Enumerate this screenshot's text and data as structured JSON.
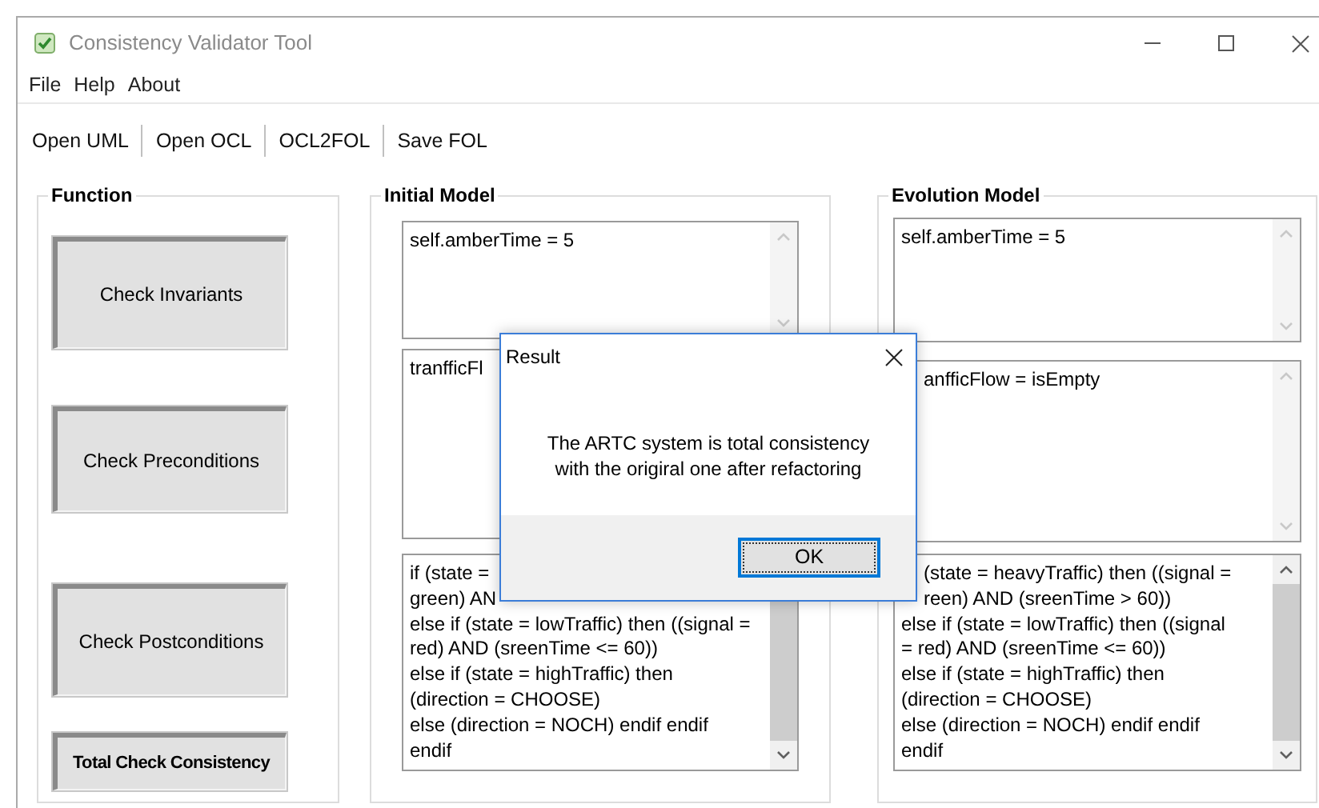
{
  "window": {
    "title": "Consistency Validator Tool"
  },
  "menu": [
    "File",
    "Help",
    "About"
  ],
  "toolbar": [
    "Open UML",
    "Open OCL",
    "OCL2FOL",
    "Save FOL"
  ],
  "function_panel": {
    "title": "Function",
    "buttons": [
      {
        "label": "Check Invariants",
        "bold": false
      },
      {
        "label": "Check Preconditions",
        "bold": false
      },
      {
        "label": "Check Postconditions",
        "bold": false
      },
      {
        "label": "Total Check Consistency",
        "bold": true
      }
    ]
  },
  "models": [
    {
      "title": "Initial Model",
      "boxes": [
        {
          "scroll_enabled": false,
          "lines": [
            {
              "text": "self.amberTime = 5",
              "kind": "full"
            }
          ]
        },
        {
          "lines": [
            {
              "text": "tranfficFl",
              "kind": "full"
            }
          ]
        },
        {
          "scroll_enabled": true,
          "lines": [
            {
              "text": "if (state =",
              "kind": "full"
            },
            {
              "text": "green) AN",
              "kind": "full"
            },
            {
              "text": "else if (state = lowTraffic) then ((signal =",
              "kind": "full"
            },
            {
              "text": "red) AND (sreenTime <= 60))",
              "kind": "full"
            },
            {
              "text": "else if (state = highTraffic) then",
              "kind": "full"
            },
            {
              "text": "(direction = CHOOSE)",
              "kind": "full"
            },
            {
              "text": "else (direction = NOCH) endif endif",
              "kind": "full"
            },
            {
              "text": "endif",
              "kind": "full"
            }
          ]
        }
      ]
    },
    {
      "title": "Evolution Model",
      "boxes": [
        {
          "scroll_enabled": false,
          "lines": [
            {
              "text": "self.amberTime = 5",
              "kind": "full"
            }
          ]
        },
        {
          "scroll_enabled": false,
          "lines": [
            {
              "text": "anfficFlow = isEmpty",
              "kind": "cut"
            }
          ]
        },
        {
          "scroll_enabled": true,
          "lines": [
            {
              "text": "(state = heavyTraffic) then ((signal =",
              "kind": "cut"
            },
            {
              "text": "reen) AND (sreenTime > 60))",
              "kind": "cut"
            },
            {
              "text": "else if (state = lowTraffic) then ((signal",
              "kind": "full"
            },
            {
              "text": "= red) AND (sreenTime <= 60))",
              "kind": "full"
            },
            {
              "text": "else if (state = highTraffic) then",
              "kind": "full"
            },
            {
              "text": "(direction = CHOOSE)",
              "kind": "full"
            },
            {
              "text": "else (direction = NOCH) endif endif",
              "kind": "full"
            },
            {
              "text": "endif",
              "kind": "full"
            }
          ]
        }
      ]
    }
  ],
  "dialog": {
    "title": "Result",
    "message": [
      "The ARTC system is total consistency",
      "with the origiral one after refactoring"
    ],
    "ok": "OK"
  }
}
